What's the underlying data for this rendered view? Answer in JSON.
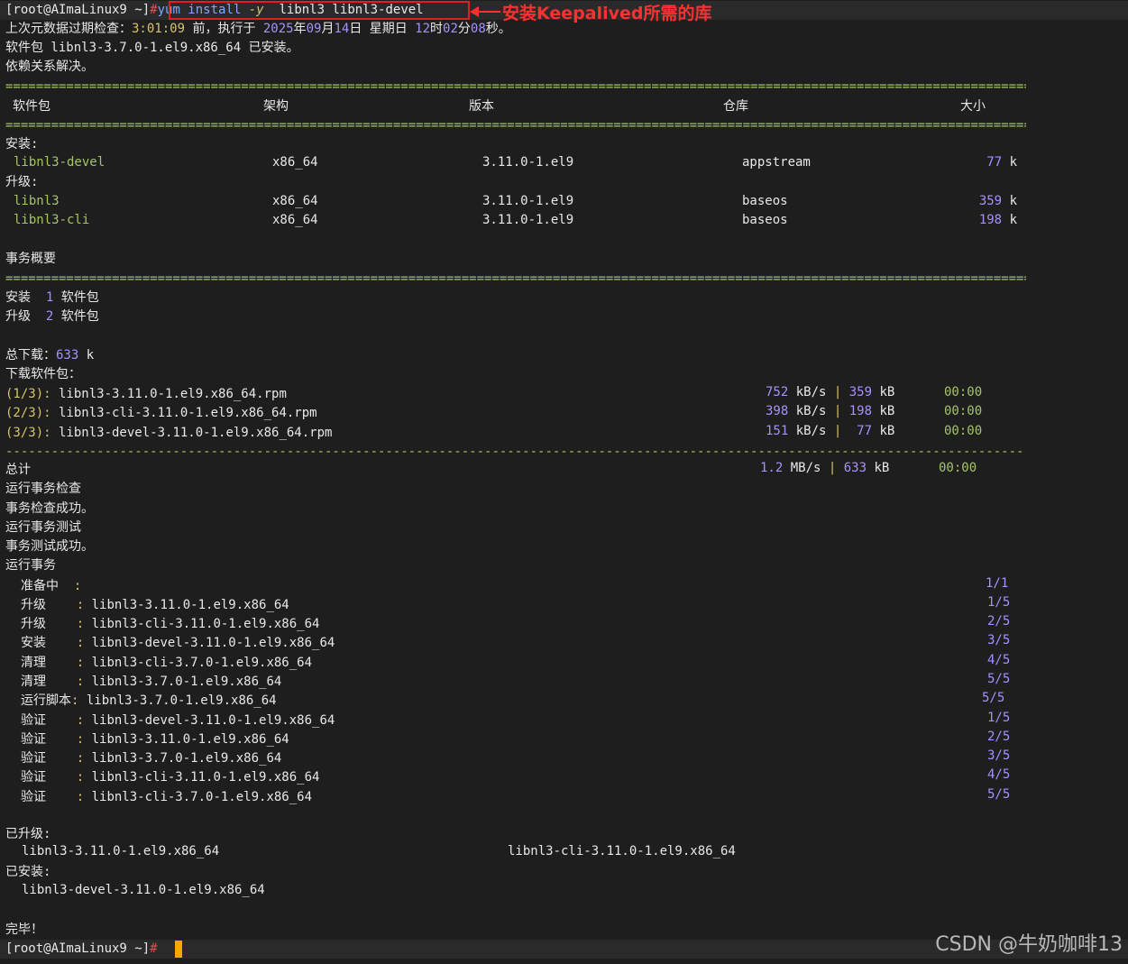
{
  "prompt": {
    "user_host": "[root@AImaLinux9 ~]",
    "hash": "#"
  },
  "command": {
    "part1": "yum install ",
    "flag": "-y",
    "part2": "  libnl3 libnl3-devel"
  },
  "annotation": "安装Keepalived所需的库",
  "meta_check": {
    "pre": "上次元数据过期检查：",
    "ago": "3:01:09",
    "mid": " 前，执行于 ",
    "year": "2025",
    "nian": "年",
    "month": "09",
    "yue": "月",
    "day": "14",
    "ri": "日 星期日 ",
    "hour": "12",
    "shi": "时",
    "min": "02",
    "fen": "分",
    "sec": "08",
    "miao": "秒。"
  },
  "already_installed": "软件包 libnl3-3.7.0-1.el9.x86_64 已安装。",
  "deps_resolved": "依赖关系解决。",
  "separator": "==========================================================================================================================================================================",
  "dash_separator": "-------------------------------------------------------------------------------------------------------------------------------------------------------------------------",
  "table_headers": {
    "package": "软件包",
    "arch": "架构",
    "version": "版本",
    "repo": "仓库",
    "size": "大小"
  },
  "install_label": "安装:",
  "upgrade_label": "升级:",
  "rows": [
    {
      "name": "libnl3-devel",
      "arch": "x86_64",
      "version": "3.11.0-1.el9",
      "repo": "appstream",
      "size": "77",
      "unit": "k"
    },
    {
      "name": "libnl3",
      "arch": "x86_64",
      "version": "3.11.0-1.el9",
      "repo": "baseos",
      "size": "359",
      "unit": "k"
    },
    {
      "name": "libnl3-cli",
      "arch": "x86_64",
      "version": "3.11.0-1.el9",
      "repo": "baseos",
      "size": "198",
      "unit": "k"
    }
  ],
  "summary_title": "事务概要",
  "summary": [
    {
      "label": "安装",
      "count": "1",
      "unit": "软件包"
    },
    {
      "label": "升级",
      "count": "2",
      "unit": "软件包"
    }
  ],
  "total_download": {
    "label": "总下载：",
    "value": "633",
    "unit": " k"
  },
  "downloading_label": "下载软件包：",
  "downloads": [
    {
      "idx": "(1/3):",
      "file": " libnl3-3.11.0-1.el9.x86_64.rpm",
      "speed": "752",
      "size": "359",
      "time": "00:00"
    },
    {
      "idx": "(2/3):",
      "file": " libnl3-cli-3.11.0-1.el9.x86_64.rpm",
      "speed": "398",
      "size": "198",
      "time": "00:00"
    },
    {
      "idx": "(3/3):",
      "file": " libnl3-devel-3.11.0-1.el9.x86_64.rpm",
      "speed": "151",
      "size": " 77",
      "time": "00:00"
    }
  ],
  "total": {
    "label": "总计",
    "speed": "1.2",
    "size": "633",
    "time": "00:00"
  },
  "speed_unit": " kB/s ",
  "mb_unit": " MB/s ",
  "pipe": "|",
  "kb": " kB",
  "tx_lines": [
    "运行事务检查",
    "事务检查成功。",
    "运行事务测试",
    "事务测试成功。",
    "运行事务"
  ],
  "steps": [
    {
      "label": "准备中",
      "sep": "  :",
      "pkg": "",
      "prog": "1/1"
    },
    {
      "label": "升级",
      "sep": "    :",
      "pkg": " libnl3-3.11.0-1.el9.x86_64",
      "prog": "1/5"
    },
    {
      "label": "升级",
      "sep": "    :",
      "pkg": " libnl3-cli-3.11.0-1.el9.x86_64",
      "prog": "2/5"
    },
    {
      "label": "安装",
      "sep": "    :",
      "pkg": " libnl3-devel-3.11.0-1.el9.x86_64",
      "prog": "3/5"
    },
    {
      "label": "清理",
      "sep": "    :",
      "pkg": " libnl3-cli-3.7.0-1.el9.x86_64",
      "prog": "4/5"
    },
    {
      "label": "清理",
      "sep": "    :",
      "pkg": " libnl3-3.7.0-1.el9.x86_64",
      "prog": "5/5"
    },
    {
      "label": "运行脚本",
      "sep": ":",
      "pkg": " libnl3-3.7.0-1.el9.x86_64",
      "prog": "5/5"
    },
    {
      "label": "验证",
      "sep": "    :",
      "pkg": " libnl3-devel-3.11.0-1.el9.x86_64",
      "prog": "1/5"
    },
    {
      "label": "验证",
      "sep": "    :",
      "pkg": " libnl3-3.11.0-1.el9.x86_64",
      "prog": "2/5"
    },
    {
      "label": "验证",
      "sep": "    :",
      "pkg": " libnl3-3.7.0-1.el9.x86_64",
      "prog": "3/5"
    },
    {
      "label": "验证",
      "sep": "    :",
      "pkg": " libnl3-cli-3.11.0-1.el9.x86_64",
      "prog": "4/5"
    },
    {
      "label": "验证",
      "sep": "    :",
      "pkg": " libnl3-cli-3.7.0-1.el9.x86_64",
      "prog": "5/5"
    }
  ],
  "upgraded_label": "已升级:",
  "upgraded": [
    "libnl3-3.11.0-1.el9.x86_64",
    "libnl3-cli-3.11.0-1.el9.x86_64"
  ],
  "installed_label": "已安装:",
  "installed": [
    "libnl3-devel-3.11.0-1.el9.x86_64"
  ],
  "done": "完毕！",
  "watermark": "CSDN @牛奶咖啡13"
}
